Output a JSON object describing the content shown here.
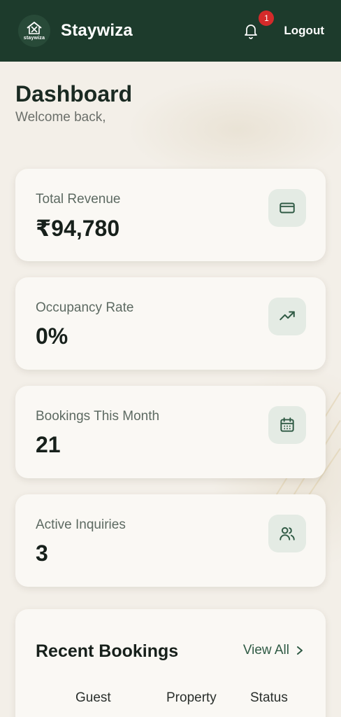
{
  "header": {
    "logo_text": "staywiza",
    "brand": "Staywiza",
    "notification_count": "1",
    "logout_label": "Logout"
  },
  "page": {
    "title": "Dashboard",
    "subtitle": "Welcome back,"
  },
  "stats": [
    {
      "label": "Total Revenue",
      "value": "₹94,780",
      "icon": "credit-card-icon"
    },
    {
      "label": "Occupancy Rate",
      "value": "0%",
      "icon": "trending-up-icon"
    },
    {
      "label": "Bookings This Month",
      "value": "21",
      "icon": "calendar-icon"
    },
    {
      "label": "Active Inquiries",
      "value": "3",
      "icon": "users-icon"
    }
  ],
  "recent_bookings": {
    "title": "Recent Bookings",
    "view_all_label": "View All",
    "columns": [
      "Guest",
      "Property",
      "Status"
    ]
  },
  "colors": {
    "header_bg": "#1d3b2c",
    "page_bg": "#f3efe8",
    "card_bg": "#faf8f4",
    "icon_tile_bg": "#e4ebe4",
    "accent": "#2f5a44",
    "badge": "#d42a2a"
  }
}
